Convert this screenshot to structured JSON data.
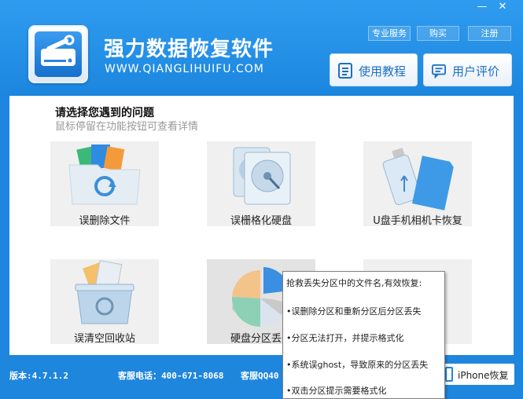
{
  "window": {
    "minimize_glyph": "—",
    "close_glyph": "✕"
  },
  "header": {
    "title": "强力数据恢复软件",
    "url": "WWW.QIANGLIHUIFU.COM",
    "links": [
      "专业服务",
      "购买",
      "注册"
    ],
    "tutorial_button": "使用教程",
    "review_button": "用户评价",
    "accent": "#1e86e0"
  },
  "content": {
    "heading": "请选择您遇到的问题",
    "subheading": "鼠标停留在功能按钮可查看详情",
    "tiles": [
      {
        "label": "误删除文件",
        "icon": "folder-files-icon"
      },
      {
        "label": "误栅格化硬盘",
        "icon": "hard-disk-icon"
      },
      {
        "label": "U盘手机相机卡恢复",
        "icon": "usb-sdcard-icon"
      },
      {
        "label": "误清空回收站",
        "icon": "recycle-bin-icon"
      },
      {
        "label": "硬盘分区丢失",
        "icon": "pie-partition-icon"
      },
      {
        "label": "",
        "icon": "blank-tile"
      }
    ]
  },
  "tooltip": {
    "lines": [
      "抢救丢失分区中的文件名,有效恢复:",
      "•误删除分区和重新分区后分区丢失",
      "•分区无法打开，并提示格式化",
      "•系统误ghost，导致原来的分区丢失",
      "•双击分区提示需要格式化"
    ]
  },
  "footer": {
    "version": "版本:4.7.1.2",
    "phone": "客服电话：400-671-8068",
    "qq": "客服QQ40",
    "iphone_button": "iPhone恢复"
  }
}
